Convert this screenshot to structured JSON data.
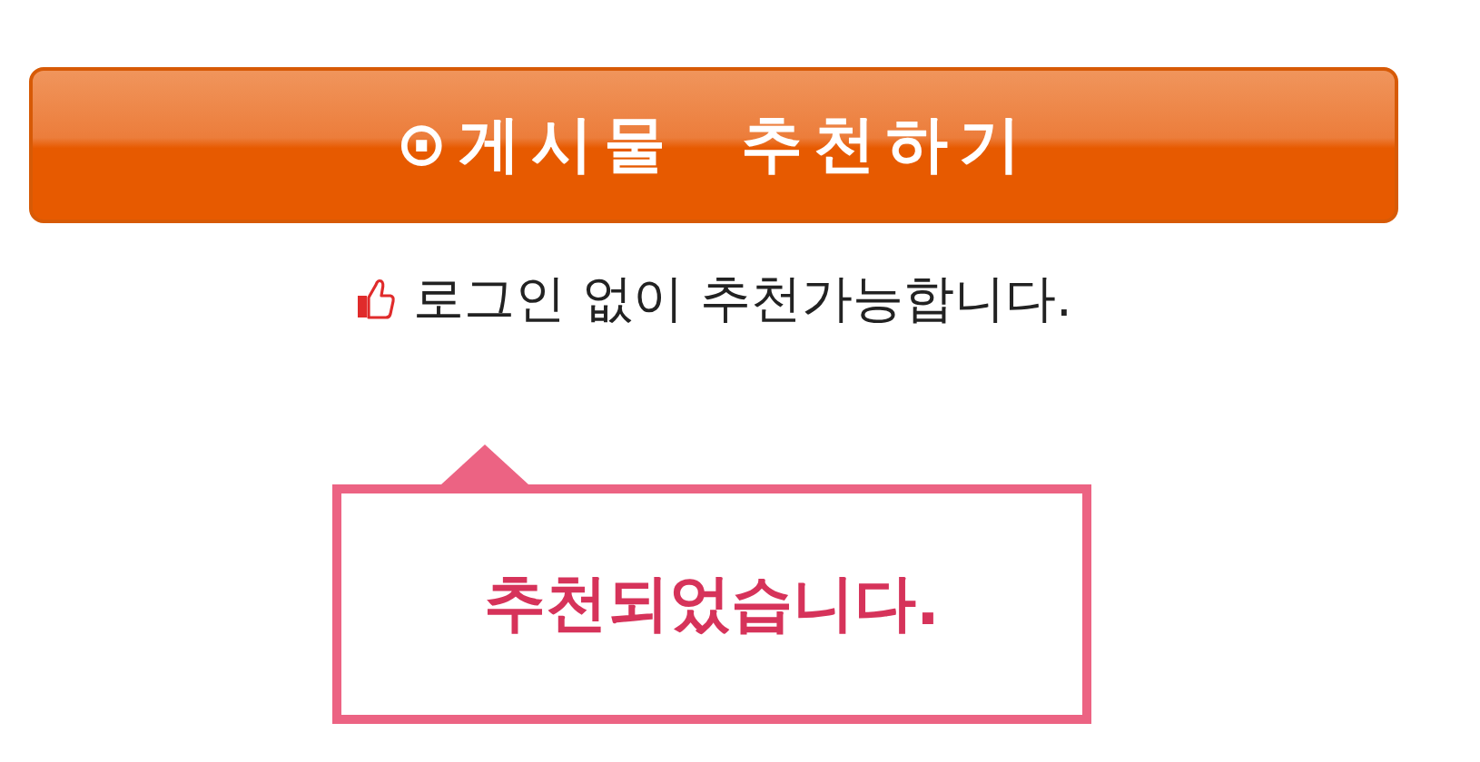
{
  "recommend_button": {
    "label": "⊙게시물  추천하기"
  },
  "note": {
    "text": "로그인 없이 추천가능합니다."
  },
  "popup": {
    "message": "추천되었습니다."
  }
}
